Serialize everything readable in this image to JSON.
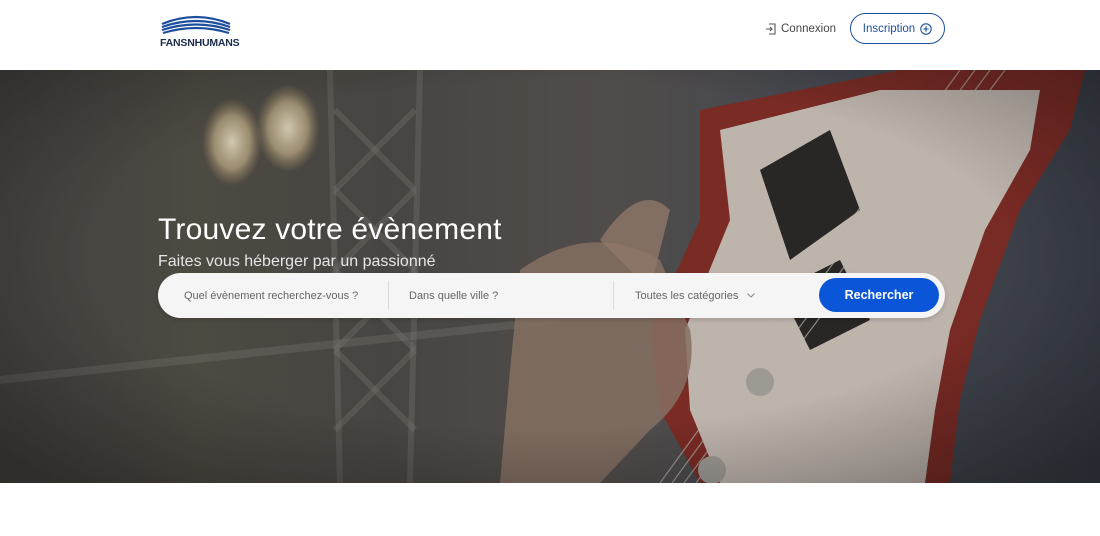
{
  "header": {
    "logo_text": "FANSNHUMANS",
    "login_label": "Connexion",
    "signup_label": "Inscription"
  },
  "hero": {
    "title": "Trouvez votre évènement",
    "subtitle": "Faites vous héberger par un passionné"
  },
  "search": {
    "event_placeholder": "Quel évènement recherchez-vous ?",
    "city_placeholder": "Dans quelle ville ?",
    "category_selected": "Toutes les catégories",
    "button_label": "Rechercher"
  },
  "colors": {
    "brand_blue": "#1d4f9c",
    "button_blue": "#0b56d8"
  },
  "icons": [
    "logo-waves-icon",
    "login-icon",
    "plus-circle-icon",
    "chevron-down-icon"
  ]
}
